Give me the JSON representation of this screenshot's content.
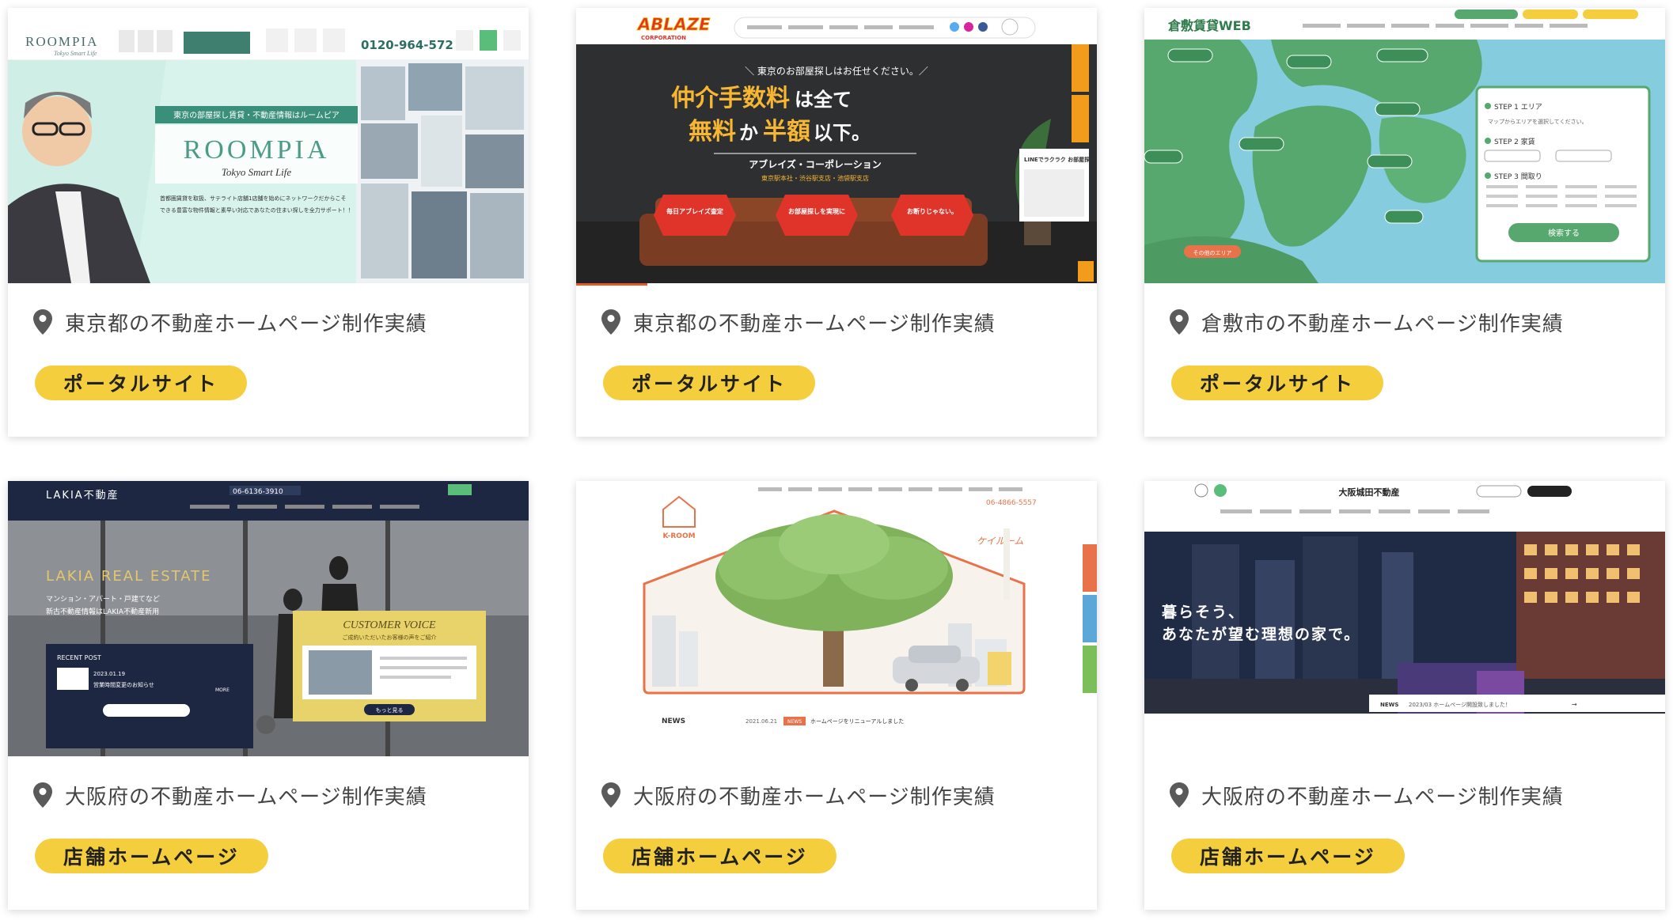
{
  "cards": [
    {
      "location": "東京都の不動産ホームページ制作実績",
      "tag": "ポータルサイト",
      "shot": {
        "logo": "ROOMPIA",
        "logo_sub": "Tokyo Smart Life",
        "phone": "0120-964-572",
        "hero_banner": "東京の部屋探し賃貸・不動産情報はルームピア",
        "hero_title": "ROOMPIA",
        "hero_script": "Tokyo Smart Life",
        "hero_line1": "首都圏賃貸を取扱、サテライト店舗1店舗を始めにネットワークだからこそ",
        "hero_line2": "できる豊富な物件情報と素早い対応であなたの住まい探しを全力サポート！！"
      }
    },
    {
      "location": "東京都の不動産ホームページ制作実績",
      "tag": "ポータルサイト",
      "shot": {
        "logo": "ABLAZE",
        "logo_sub": "CORPORATION",
        "lead": "＼ 東京のお部屋探しはお任せください。／",
        "headline1a": "仲介手数料",
        "headline1b": "は全て",
        "headline2a": "無料",
        "headline2b": "か",
        "headline2c": "半額",
        "headline2d": "以下。",
        "company": "アブレイズ・コーポレーション",
        "sub": "東京駅本社・渋谷駅支店・池袋駅支店",
        "badge1": "毎日アブレイズ査定",
        "badge2": "お部屋探しを実現に",
        "badge3": "お断りじゃない。",
        "line_label": "LINEでラクラク お部屋探し!"
      }
    },
    {
      "location": "倉敷市の不動産ホームページ制作実績",
      "tag": "ポータルサイト",
      "shot": {
        "logo": "倉敷賃貸WEB",
        "step1": "STEP 1 エリア",
        "step1_hint": "マップからエリアを選択してください。",
        "step2": "STEP 2 家賃",
        "step3": "STEP 3 間取り",
        "search_button": "検索する",
        "other_area": "その他のエリア"
      }
    },
    {
      "location": "大阪府の不動産ホームページ制作実績",
      "tag": "店舗ホームページ",
      "shot": {
        "logo": "LAKIA不動産",
        "phone": "06-6136-3910",
        "hero_title": "LAKIA REAL ESTATE",
        "hero_sub1": "マンション・アパート・戸建てなど",
        "hero_sub2": "新古不動産情報はLAKIA不動産新用",
        "voice_title": "CUSTOMER VOICE",
        "voice_sub": "ご成約いただいたお客様の声をご紹介",
        "recent_label": "RECENT POST",
        "recent_date": "2023.01.19",
        "recent_item": "営業時間変更のお知らせ",
        "more": "MORE",
        "more_btn": "もっと見る"
      }
    },
    {
      "location": "大阪府の不動産ホームページ制作実績",
      "tag": "店舗ホームページ",
      "shot": {
        "logo": "K-ROOM",
        "phone": "06-4866-5557",
        "script": "ケイルーム",
        "news_label": "NEWS",
        "news_date": "2021.06.21",
        "news_badge": "NEWS",
        "news_item": "ホームページをリニューアルしました"
      }
    },
    {
      "location": "大阪府の不動産ホームページ制作実績",
      "tag": "店舗ホームページ",
      "shot": {
        "logo": "大阪城田不動産",
        "hero1": "暮らそう、",
        "hero2": "あなたが望む理想の家で。",
        "news_label": "NEWS",
        "news_item": "2023/03 ホームページ開設致しました！"
      }
    }
  ],
  "colors": {
    "tag_bg": "#f5ce3e",
    "accent_orange": "#e55a2b",
    "roompia_mint": "#d7f3ec",
    "kurashiki_green": "#57a86e",
    "kurashiki_sea": "#86ccdf",
    "lakia_navy": "#1d2742"
  }
}
